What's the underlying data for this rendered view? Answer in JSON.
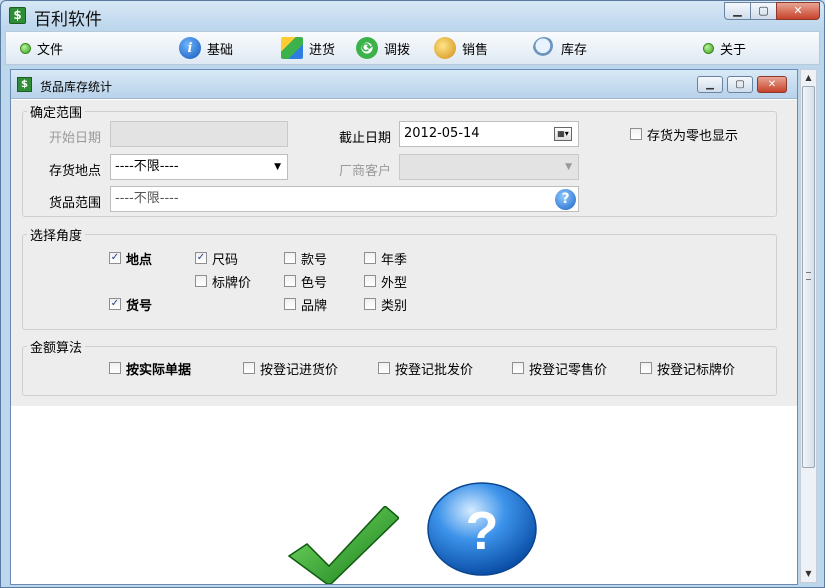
{
  "app": {
    "title": "百利软件",
    "icon": "dollar-app-icon"
  },
  "window_buttons": {
    "minimize": "▁",
    "maximize": "▢",
    "close": "✕"
  },
  "menu": {
    "items": [
      {
        "label": "文件",
        "icon": "green-dot-icon"
      },
      {
        "label": "基础",
        "icon": "info-icon"
      },
      {
        "label": "进货",
        "icon": "cubes-icon"
      },
      {
        "label": "调拨",
        "icon": "refresh-arrows-icon"
      },
      {
        "label": "销售",
        "icon": "coins-icon"
      },
      {
        "label": "库存",
        "icon": "magnifier-icon"
      },
      {
        "label": "关于",
        "icon": "green-dot-icon"
      }
    ]
  },
  "child_window": {
    "title": "货品库存统计",
    "buttons": {
      "minimize": "▁",
      "maximize": "▢",
      "close": "✕"
    }
  },
  "range_group": {
    "legend": "确定范围",
    "start_date_label": "开始日期",
    "start_date_value": "",
    "end_date_label": "截止日期",
    "end_date_value": "2012-05-14",
    "zero_stock_label": "存货为零也显示",
    "zero_stock_checked": false,
    "location_label": "存货地点",
    "location_value": "----不限----",
    "vendor_label": "厂商客户",
    "vendor_value": "",
    "goods_range_label": "货品范围",
    "goods_range_value": "----不限----",
    "help_glyph": "?"
  },
  "angle_group": {
    "legend": "选择角度",
    "options": {
      "location": {
        "label": "地点",
        "checked": true
      },
      "size": {
        "label": "尺码",
        "checked": true
      },
      "style_no": {
        "label": "款号",
        "checked": false
      },
      "season": {
        "label": "年季",
        "checked": false
      },
      "tag_price": {
        "label": "标牌价",
        "checked": false
      },
      "color_no": {
        "label": "色号",
        "checked": false
      },
      "shape": {
        "label": "外型",
        "checked": false
      },
      "item_no": {
        "label": "货号",
        "checked": true
      },
      "brand": {
        "label": "品牌",
        "checked": false
      },
      "category": {
        "label": "类别",
        "checked": false
      }
    }
  },
  "amount_group": {
    "legend": "金额算法",
    "options": {
      "actual": {
        "label": "按实际单据",
        "checked": false
      },
      "purchase": {
        "label": "按登记进货价",
        "checked": false
      },
      "wholesale": {
        "label": "按登记批发价",
        "checked": false
      },
      "retail": {
        "label": "按登记零售价",
        "checked": false
      },
      "tag": {
        "label": "按登记标牌价",
        "checked": false
      }
    }
  },
  "check_mark": "✓",
  "colors": {
    "accent_green": "#2e8d36",
    "help_blue": "#1b64c8"
  }
}
